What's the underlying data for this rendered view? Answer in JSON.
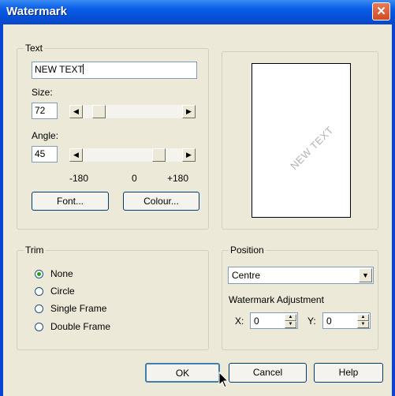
{
  "window": {
    "title": "Watermark"
  },
  "text_group": {
    "label": "Text",
    "text_value": "NEW TEXT",
    "size_label": "Size:",
    "size_value": "72",
    "angle_label": "Angle:",
    "angle_value": "45",
    "scale_min": "-180",
    "scale_mid": "0",
    "scale_max": "+180",
    "font_button": "Font...",
    "colour_button": "Colour..."
  },
  "preview": {
    "watermark_text": "NEW TEXT"
  },
  "trim_group": {
    "label": "Trim",
    "options": [
      "None",
      "Circle",
      "Single Frame",
      "Double Frame"
    ],
    "selected": "None"
  },
  "position_group": {
    "label": "Position",
    "selected": "Centre",
    "adjust_label": "Watermark Adjustment",
    "x_label": "X:",
    "x_value": "0",
    "y_label": "Y:",
    "y_value": "0"
  },
  "buttons": {
    "ok": "OK",
    "cancel": "Cancel",
    "help": "Help"
  },
  "icons": {
    "close": "close-icon",
    "scroll_left": "arrow-left-icon",
    "scroll_right": "arrow-right-icon",
    "dropdown": "chevron-down-icon",
    "spin": "spin-arrows-icon",
    "cursor": "mouse-pointer-icon"
  }
}
